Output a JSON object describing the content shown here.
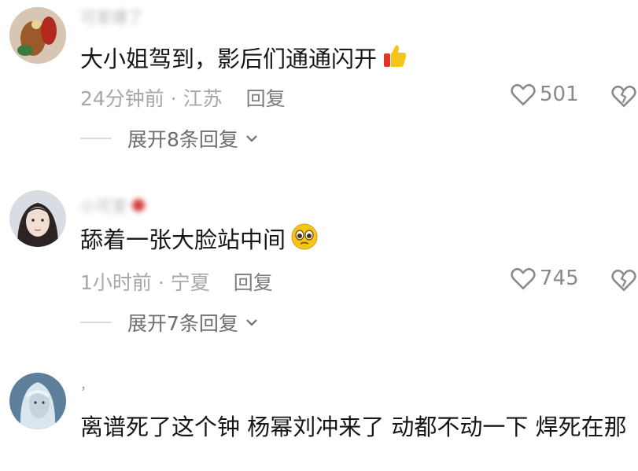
{
  "comments": [
    {
      "username": "可爱爆了",
      "text": "大小姐驾到，影后们通通闪开",
      "time_location": "24分钟前 · 江苏",
      "reply_label": "回复",
      "likes": "501",
      "expand_label": "展开8条回复",
      "avatar_icon": "avatar-ornament-icon",
      "emoji_icon": "thumbs-up-icon"
    },
    {
      "username": "小可爱",
      "text": "舔着一张大脸站中间",
      "time_location": "1小时前 · 宁夏",
      "reply_label": "回复",
      "likes": "745",
      "expand_label": "展开7条回复",
      "avatar_icon": "avatar-portrait-icon",
      "emoji_icon": "pleading-face-icon"
    },
    {
      "username": "，",
      "text": "离谱死了这个钟 杨幂刘冲来了 动都不动一下 焊死在那",
      "avatar_icon": "avatar-elf-icon"
    }
  ],
  "colors": {
    "text_primary": "#161616",
    "text_secondary": "#a7a7a7",
    "icon_gray": "#8a8a8a",
    "emoji_yellow": "#f5c518"
  }
}
